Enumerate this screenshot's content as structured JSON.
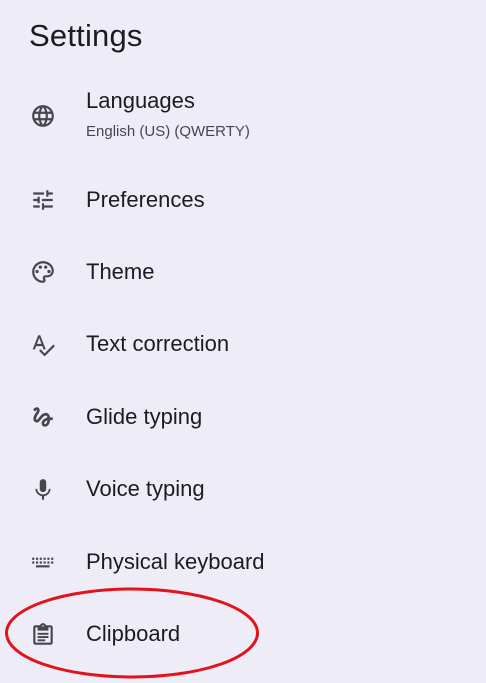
{
  "header": {
    "title": "Settings"
  },
  "items": [
    {
      "label": "Languages",
      "summary": "English (US) (QWERTY)",
      "icon": "globe-icon"
    },
    {
      "label": "Preferences",
      "icon": "tune-icon"
    },
    {
      "label": "Theme",
      "icon": "palette-icon"
    },
    {
      "label": "Text correction",
      "icon": "spellcheck-icon"
    },
    {
      "label": "Glide typing",
      "icon": "gesture-icon"
    },
    {
      "label": "Voice typing",
      "icon": "microphone-icon"
    },
    {
      "label": "Physical keyboard",
      "icon": "keyboard-icon"
    },
    {
      "label": "Clipboard",
      "icon": "clipboard-icon"
    }
  ],
  "annotation": {
    "highlight_color": "#e0141a",
    "highlighted_item": "Clipboard"
  },
  "colors": {
    "background": "#eeedf7",
    "icon": "#46464f",
    "text": "#1c1b1f"
  }
}
